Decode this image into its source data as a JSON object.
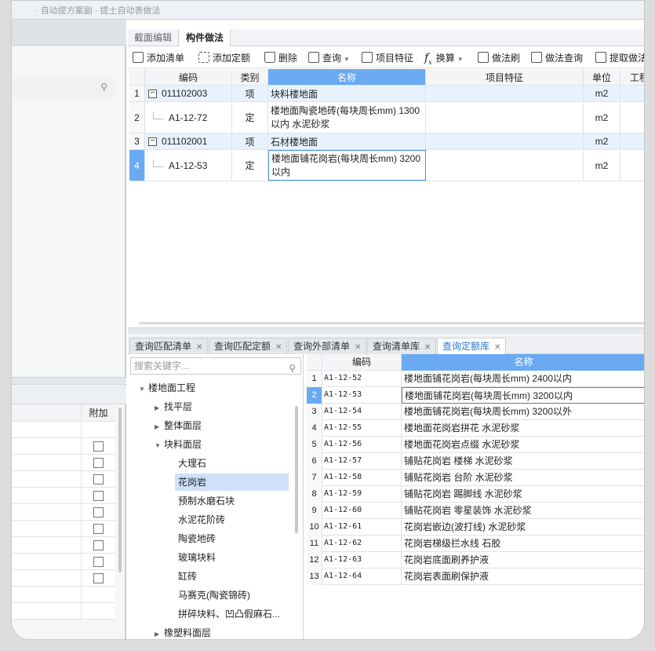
{
  "top_strip": {
    "text": "· 自动提方案副 · 提土自动表做法"
  },
  "tabs": [
    {
      "label": "截面编辑"
    },
    {
      "label": "构件做法"
    }
  ],
  "toolbar": {
    "add_list": "添加清单",
    "add_quota": "添加定额",
    "delete": "删除",
    "query": "查询",
    "item_feature": "项目特征",
    "convert": "换算",
    "method_brush": "做法刷",
    "method_query": "做法查询",
    "extract": "提取做法"
  },
  "grid1": {
    "headers": {
      "code": "编码",
      "category": "类别",
      "name": "名称",
      "feature": "项目特征",
      "unit": "单位",
      "work": "工程"
    },
    "rows": [
      {
        "num": "1",
        "code": "011102003",
        "category": "项",
        "name": "块料楼地面",
        "unit": "m2",
        "group": true
      },
      {
        "num": "2",
        "code": "A1-12-72",
        "category": "定",
        "name": "楼地面陶瓷地砖(每块周长mm) 1300以内 水泥砂浆",
        "unit": "m2",
        "group": false
      },
      {
        "num": "3",
        "code": "011102001",
        "category": "项",
        "name": "石材楼地面",
        "unit": "m2",
        "group": true
      },
      {
        "num": "4",
        "code": "A1-12-53",
        "category": "定",
        "name": "楼地面铺花岗岩(每块周长mm) 3200以内",
        "unit": "m2",
        "group": false
      }
    ]
  },
  "bottom_tabs": [
    {
      "label": "查询匹配清单"
    },
    {
      "label": "查询匹配定额"
    },
    {
      "label": "查询外部清单"
    },
    {
      "label": "查询清单库"
    },
    {
      "label": "查询定额库"
    }
  ],
  "tree": {
    "search_placeholder": "搜索关键字...",
    "items": [
      {
        "label": "楼地面工程"
      },
      {
        "label": "找平层"
      },
      {
        "label": "整体面层"
      },
      {
        "label": "块料面层"
      },
      {
        "label": "大理石"
      },
      {
        "label": "花岗岩"
      },
      {
        "label": "预制水磨石块"
      },
      {
        "label": "水泥花阶砖"
      },
      {
        "label": "陶瓷地砖"
      },
      {
        "label": "玻璃块料"
      },
      {
        "label": "缸砖"
      },
      {
        "label": "马赛克(陶瓷锦砖)"
      },
      {
        "label": "拼碎块料、凹凸假麻石..."
      },
      {
        "label": "橡塑料面层"
      }
    ]
  },
  "grid2": {
    "headers": {
      "code": "编码",
      "name": "名称"
    },
    "rows": [
      {
        "num": "1",
        "code": "A1-12-52",
        "name": "楼地面铺花岗岩(每块周长mm) 2400以内"
      },
      {
        "num": "2",
        "code": "A1-12-53",
        "name": "楼地面铺花岗岩(每块周长mm) 3200以内"
      },
      {
        "num": "3",
        "code": "A1-12-54",
        "name": "楼地面铺花岗岩(每块周长mm) 3200以外"
      },
      {
        "num": "4",
        "code": "A1-12-55",
        "name": "楼地面花岗岩拼花 水泥砂浆"
      },
      {
        "num": "5",
        "code": "A1-12-56",
        "name": "楼地面花岗岩点缀 水泥砂浆"
      },
      {
        "num": "6",
        "code": "A1-12-57",
        "name": "铺贴花岗岩 楼梯 水泥砂浆"
      },
      {
        "num": "7",
        "code": "A1-12-58",
        "name": "铺贴花岗岩 台阶 水泥砂浆"
      },
      {
        "num": "8",
        "code": "A1-12-59",
        "name": "铺贴花岗岩 踢脚线 水泥砂浆"
      },
      {
        "num": "9",
        "code": "A1-12-60",
        "name": "铺贴花岗岩 零星装饰 水泥砂浆"
      },
      {
        "num": "10",
        "code": "A1-12-61",
        "name": "花岗岩嵌边(波打线) 水泥砂浆"
      },
      {
        "num": "11",
        "code": "A1-12-62",
        "name": "花岗岩梯级拦水线 石胶"
      },
      {
        "num": "12",
        "code": "A1-12-63",
        "name": "花岗岩底面刷养护液"
      },
      {
        "num": "13",
        "code": "A1-12-64",
        "name": "花岗岩表面刷保护液"
      }
    ]
  },
  "left_panel": {
    "extra_col": "附加"
  },
  "colors": {
    "accent": "#6aaaf2",
    "selected_tree": "#cfe2fa",
    "active_tab_text": "#2a7ad2"
  }
}
